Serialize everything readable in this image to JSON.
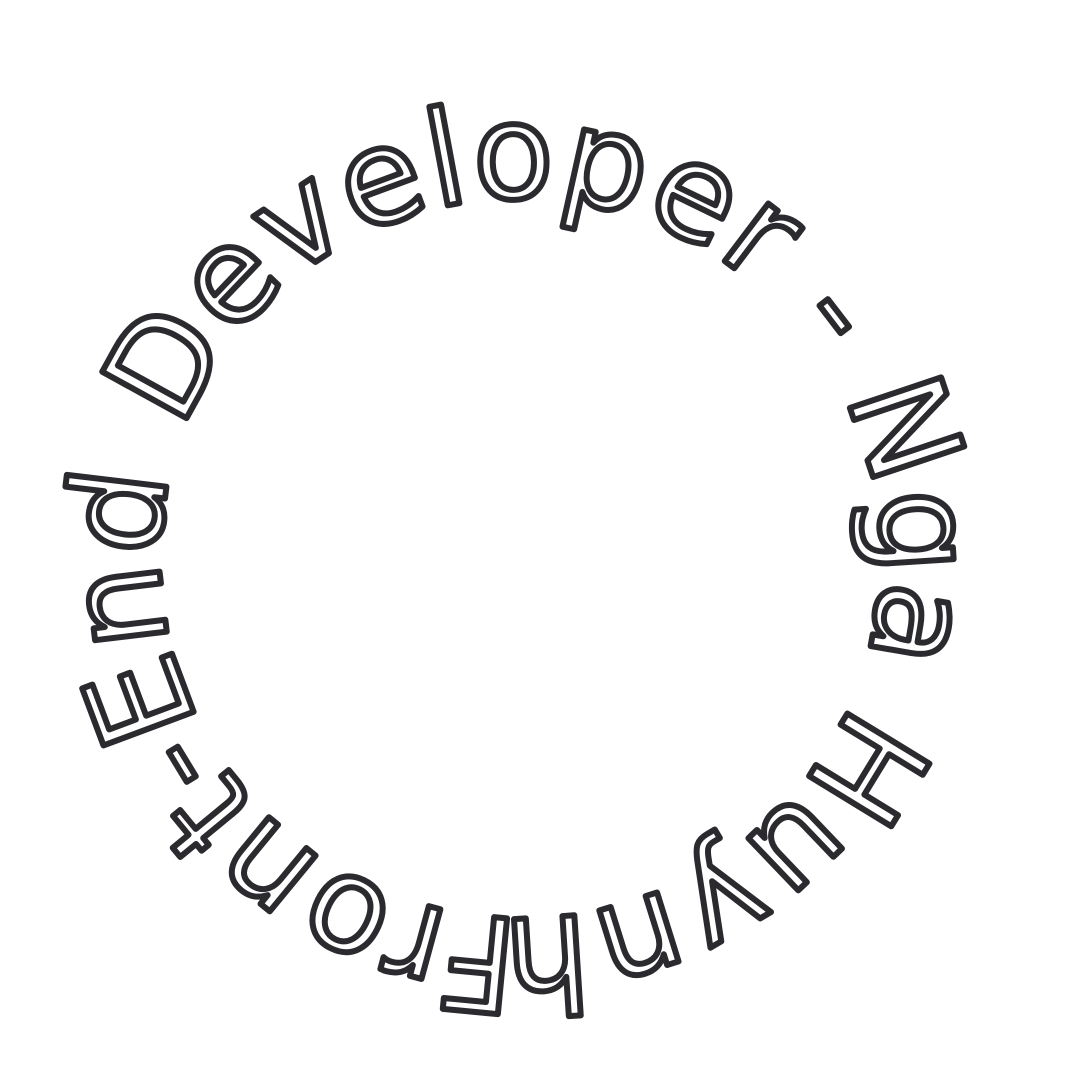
{
  "circular_text": "Front-End Developer - Nga Huynh-",
  "text_color": "#2b2b2f",
  "background_color": "#ffffff"
}
